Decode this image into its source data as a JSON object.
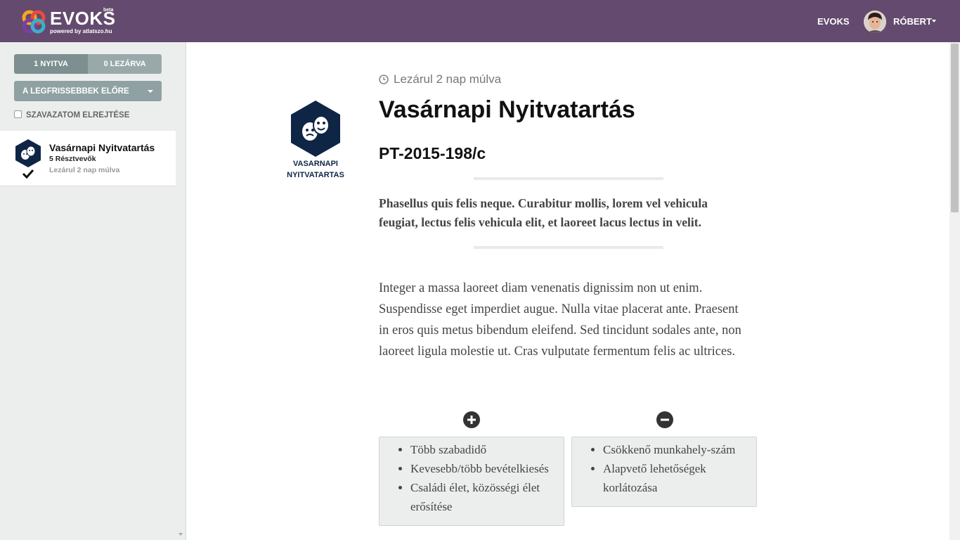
{
  "header": {
    "logo_text": "EVOKS",
    "logo_beta": "beta",
    "logo_sub": "powered by atlatszo.hu",
    "nav_link": "EVOKS",
    "user_name": "RÓBERT",
    "bg_color": "#634a6e"
  },
  "sidebar": {
    "tab_open": "1 NYITVA",
    "tab_closed": "0 LEZÁRVA",
    "sort_label": "A LEGFRISSEBBEK ELŐRE",
    "hide_vote_label": "SZAVAZATOM ELREJTÉSE",
    "items": [
      {
        "title": "Vasárnapi Nyitvatartás",
        "participants": "5 Résztvevők",
        "closes": "Lezárul 2 nap múlva",
        "icon": "theater-masks-icon",
        "voted": true
      }
    ]
  },
  "main": {
    "category_icon": "theater-masks-icon",
    "category_label": "VASARNAPI NYITVATARTAS",
    "closes": "Lezárul 2 nap múlva",
    "title": "Vasárnapi Nyitvatartás",
    "code": "PT-2015-198/c",
    "lead": "Phasellus quis felis neque. Curabitur mollis, lorem vel vehicula feugiat, lectus felis vehicula elit, et laoreet lacus lectus in velit.",
    "body": "Integer a massa laoreet diam venenatis dignissim non ut enim. Suspendisse eget imperdiet augue. Nulla vitae placerat ante. Praesent in eros quis metus bibendum eleifend. Sed tincidunt sodales ante, non laoreet ligula molestie ut. Cras vulputate fermentum felis ac ultrices.",
    "pros": [
      "Több szabadidő",
      "Kevesebb/több bevételkiesés",
      "Családi élet, közösségi élet erősítése"
    ],
    "cons": [
      "Csökkenő munkahely-szám",
      "Alapvető lehetőségek korlátozása"
    ]
  },
  "colors": {
    "icon_navy": "#0f2546",
    "sidebar_bg": "#eceeee"
  }
}
